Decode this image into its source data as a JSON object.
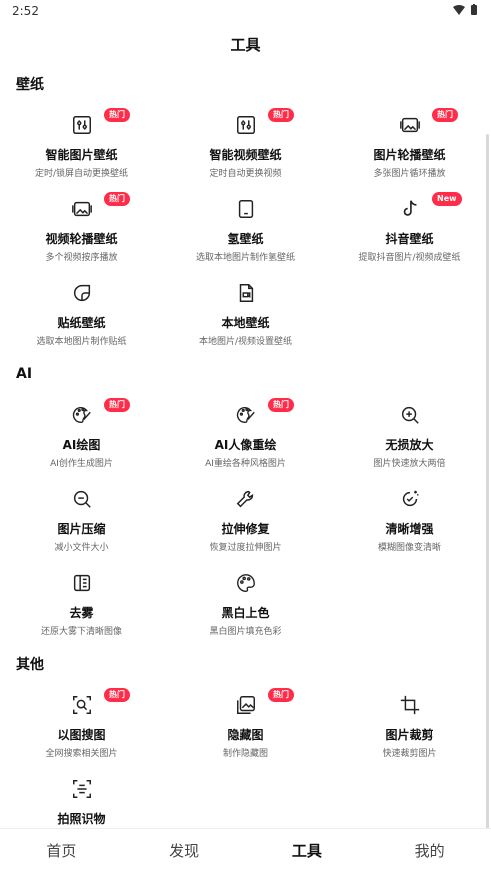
{
  "status": {
    "time": "2:52"
  },
  "header": {
    "title": "工具"
  },
  "sections": {
    "wallpaper": {
      "title": "壁纸",
      "items": [
        {
          "name": "智能图片壁纸",
          "sub": "定时/锁屏自动更换壁纸",
          "badge": "热门",
          "icon": "image-adjust-icon"
        },
        {
          "name": "智能视频壁纸",
          "sub": "定时自动更换视频",
          "badge": "热门",
          "icon": "video-adjust-icon"
        },
        {
          "name": "图片轮播壁纸",
          "sub": "多张图片循环播放",
          "badge": "热门",
          "icon": "image-carousel-icon"
        },
        {
          "name": "视频轮播壁纸",
          "sub": "多个视频按序播放",
          "badge": "热门",
          "icon": "video-carousel-icon"
        },
        {
          "name": "氢壁纸",
          "sub": "选取本地图片制作氢壁纸",
          "badge": "",
          "icon": "phone-icon"
        },
        {
          "name": "抖音壁纸",
          "sub": "提取抖音图片/视频成壁纸",
          "badge": "New",
          "icon": "tiktok-icon"
        },
        {
          "name": "贴纸壁纸",
          "sub": "选取本地图片制作贴纸",
          "badge": "",
          "icon": "sticker-icon"
        },
        {
          "name": "本地壁纸",
          "sub": "本地图片/视频设置壁纸",
          "badge": "",
          "icon": "local-file-icon"
        }
      ]
    },
    "ai": {
      "title": "AI",
      "items": [
        {
          "name": "AI绘图",
          "sub": "AI创作生成图片",
          "badge": "热门",
          "icon": "palette-brush-icon"
        },
        {
          "name": "AI人像重绘",
          "sub": "AI重绘各种风格图片",
          "badge": "热门",
          "icon": "palette-brush-icon"
        },
        {
          "name": "无损放大",
          "sub": "图片快速放大两倍",
          "badge": "",
          "icon": "zoom-in-icon"
        },
        {
          "name": "图片压缩",
          "sub": "减小文件大小",
          "badge": "",
          "icon": "zoom-out-icon"
        },
        {
          "name": "拉伸修复",
          "sub": "恢复过度拉伸图片",
          "badge": "",
          "icon": "wrench-icon"
        },
        {
          "name": "清晰增强",
          "sub": "模糊图像变清晰",
          "badge": "",
          "icon": "sparkle-enhance-icon"
        },
        {
          "name": "去雾",
          "sub": "还原大雾下清晰图像",
          "badge": "",
          "icon": "dehaze-icon"
        },
        {
          "name": "黑白上色",
          "sub": "黑白图片填充色彩",
          "badge": "",
          "icon": "color-palette-icon"
        }
      ]
    },
    "other": {
      "title": "其他",
      "items": [
        {
          "name": "以图搜图",
          "sub": "全网搜索相关图片",
          "badge": "热门",
          "icon": "image-search-icon"
        },
        {
          "name": "隐藏图",
          "sub": "制作隐藏图",
          "badge": "热门",
          "icon": "hidden-image-icon"
        },
        {
          "name": "图片裁剪",
          "sub": "快速裁剪图片",
          "badge": "",
          "icon": "crop-icon"
        },
        {
          "name": "拍照识物",
          "sub": "",
          "badge": "",
          "icon": "scan-icon"
        }
      ]
    }
  },
  "nav": {
    "items": [
      "首页",
      "发现",
      "工具",
      "我的"
    ],
    "active": "工具"
  },
  "colors": {
    "badge": "#ff2d4a",
    "text": "#111111",
    "subtext": "#666666"
  }
}
